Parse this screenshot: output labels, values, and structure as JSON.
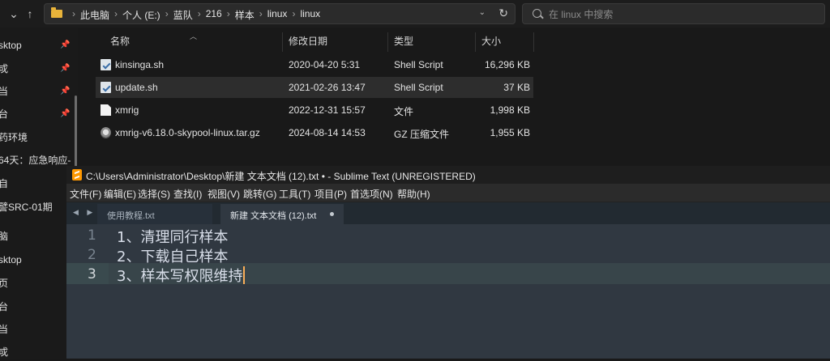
{
  "explorer": {
    "breadcrumbs": [
      "此电脑",
      "个人 (E:)",
      "蓝队",
      "216",
      "样本",
      "linux",
      "linux"
    ],
    "search_placeholder": "在 linux 中搜索",
    "columns": {
      "name": "名称",
      "modified": "修改日期",
      "type": "类型",
      "size": "大小"
    },
    "files": [
      {
        "name": "kinsinga.sh",
        "modified": "2020-04-20 5:31",
        "type": "Shell Script",
        "size": "16,296 KB",
        "icon": "shell-script-icon",
        "selected": false
      },
      {
        "name": "update.sh",
        "modified": "2021-02-26 13:47",
        "type": "Shell Script",
        "size": "37 KB",
        "icon": "shell-script-icon",
        "selected": true
      },
      {
        "name": "xmrig",
        "modified": "2022-12-31 15:57",
        "type": "文件",
        "size": "1,998 KB",
        "icon": "file-icon",
        "selected": false
      },
      {
        "name": "xmrig-v6.18.0-skypool-linux.tar.gz",
        "modified": "2024-08-14 14:53",
        "type": "GZ 压缩文件",
        "size": "1,955 KB",
        "icon": "archive-icon",
        "selected": false
      }
    ],
    "sidebar": [
      "sktop",
      "戓",
      "当",
      "台",
      "药环境",
      "64天：应急响应-",
      "自",
      "譬SRC-01期",
      "脑",
      "sktop",
      "页",
      "台",
      "当",
      "戓"
    ]
  },
  "sublime": {
    "title": "C:\\Users\\Administrator\\Desktop\\新建 文本文档 (12).txt • - Sublime Text (UNREGISTERED)",
    "menu": [
      "文件(F)",
      "编辑(E)",
      "选择(S)",
      "查找(I)",
      "视图(V)",
      "跳转(G)",
      "工具(T)",
      "项目(P)",
      "首选项(N)",
      "帮助(H)"
    ],
    "tabs": [
      {
        "label": "使用教程.txt",
        "active": false
      },
      {
        "label": "新建 文本文档 (12).txt",
        "active": true,
        "modified": true
      }
    ],
    "lines": [
      {
        "num": "1",
        "text": "1、清理同行样本"
      },
      {
        "num": "2",
        "text": "2、下载自己样本"
      },
      {
        "num": "3",
        "text": "3、样本写权限维持"
      }
    ],
    "current_line": 3
  }
}
